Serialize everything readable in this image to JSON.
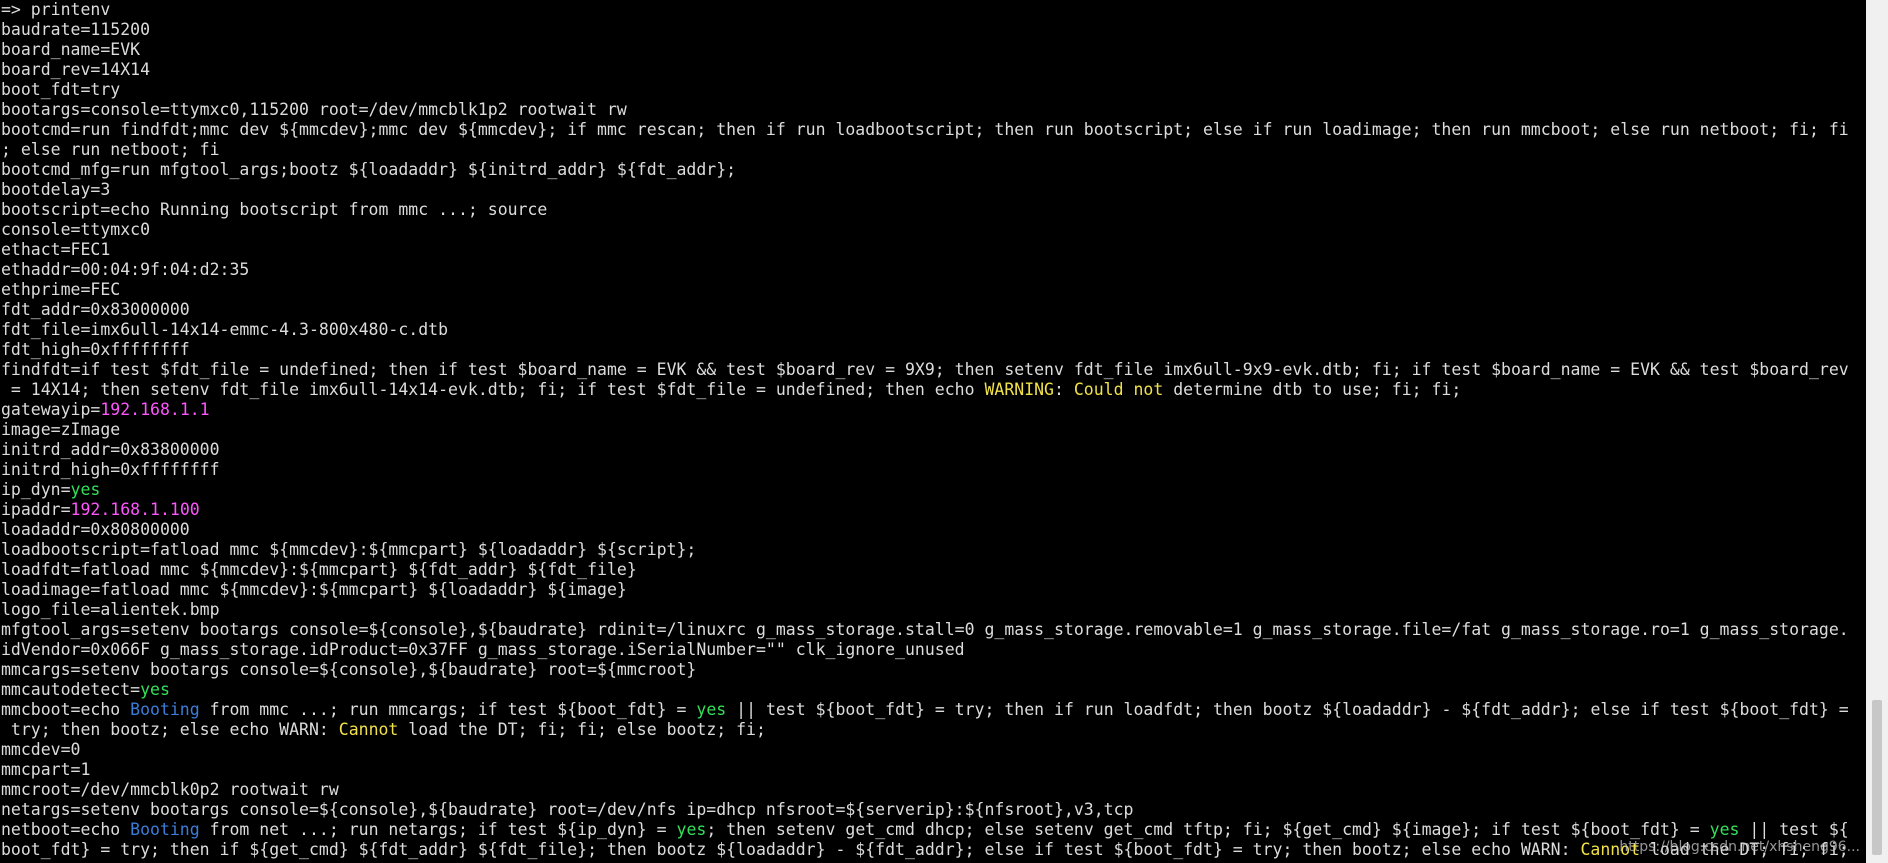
{
  "terminal": {
    "background": "#000000",
    "default_color": "#dcdcdc",
    "lines": [
      [
        {
          "t": "=> printenv"
        }
      ],
      [
        {
          "t": "baudrate=115200"
        }
      ],
      [
        {
          "t": "board_name=EVK"
        }
      ],
      [
        {
          "t": "board_rev=14X14"
        }
      ],
      [
        {
          "t": "boot_fdt=try"
        }
      ],
      [
        {
          "t": "bootargs=console=ttymxc0,115200 root=/dev/mmcblk1p2 rootwait rw"
        }
      ],
      [
        {
          "t": "bootcmd=run findfdt;mmc dev ${mmcdev};mmc dev ${mmcdev}; if mmc rescan; then if run loadbootscript; then run bootscript; else if run loadimage; then run mmcboot; else run netboot; fi; fi"
        }
      ],
      [
        {
          "t": "; else run netboot; fi"
        }
      ],
      [
        {
          "t": "bootcmd_mfg=run mfgtool_args;bootz ${loadaddr} ${initrd_addr} ${fdt_addr};"
        }
      ],
      [
        {
          "t": "bootdelay=3"
        }
      ],
      [
        {
          "t": "bootscript=echo Running bootscript from mmc ...; source"
        }
      ],
      [
        {
          "t": "console=ttymxc0"
        }
      ],
      [
        {
          "t": "ethact=FEC1"
        }
      ],
      [
        {
          "t": "ethaddr=00:04:9f:04:d2:35"
        }
      ],
      [
        {
          "t": "ethprime=FEC"
        }
      ],
      [
        {
          "t": "fdt_addr=0x83000000"
        }
      ],
      [
        {
          "t": "fdt_file=imx6ull-14x14-emmc-4.3-800x480-c.dtb"
        }
      ],
      [
        {
          "t": "fdt_high=0xffffffff"
        }
      ],
      [
        {
          "t": "findfdt=if test $fdt_file = undefined; then if test $board_name = EVK && test $board_rev = 9X9; then setenv fdt_file imx6ull-9x9-evk.dtb; fi; if test $board_name = EVK && test $board_rev"
        }
      ],
      [
        {
          "t": " = 14X14; then setenv fdt_file imx6ull-14x14-evk.dtb; fi; if test $fdt_file = undefined; then echo "
        },
        {
          "t": "WARNING",
          "c": "yellow"
        },
        {
          "t": ": "
        },
        {
          "t": "Could not",
          "c": "yellow"
        },
        {
          "t": " determine dtb to use; fi; fi;"
        }
      ],
      [
        {
          "t": "gatewayip="
        },
        {
          "t": "192.168.1.1",
          "c": "ip"
        }
      ],
      [
        {
          "t": "image=zImage"
        }
      ],
      [
        {
          "t": "initrd_addr=0x83800000"
        }
      ],
      [
        {
          "t": "initrd_high=0xffffffff"
        }
      ],
      [
        {
          "t": "ip_dyn="
        },
        {
          "t": "yes",
          "c": "yes"
        }
      ],
      [
        {
          "t": "ipaddr="
        },
        {
          "t": "192.168.1.100",
          "c": "ip"
        }
      ],
      [
        {
          "t": "loadaddr=0x80800000"
        }
      ],
      [
        {
          "t": "loadbootscript=fatload mmc ${mmcdev}:${mmcpart} ${loadaddr} ${script};"
        }
      ],
      [
        {
          "t": "loadfdt=fatload mmc ${mmcdev}:${mmcpart} ${fdt_addr} ${fdt_file}"
        }
      ],
      [
        {
          "t": "loadimage=fatload mmc ${mmcdev}:${mmcpart} ${loadaddr} ${image}"
        }
      ],
      [
        {
          "t": "logo_file=alientek.bmp"
        }
      ],
      [
        {
          "t": "mfgtool_args=setenv bootargs console=${console},${baudrate} rdinit=/linuxrc g_mass_storage.stall=0 g_mass_storage.removable=1 g_mass_storage.file=/fat g_mass_storage.ro=1 g_mass_storage."
        }
      ],
      [
        {
          "t": "idVendor=0x066F g_mass_storage.idProduct=0x37FF g_mass_storage.iSerialNumber=\"\" clk_ignore_unused"
        }
      ],
      [
        {
          "t": "mmcargs=setenv bootargs console=${console},${baudrate} root=${mmcroot}"
        }
      ],
      [
        {
          "t": "mmcautodetect="
        },
        {
          "t": "yes",
          "c": "yes"
        }
      ],
      [
        {
          "t": "mmcboot=echo "
        },
        {
          "t": "Booting",
          "c": "blue"
        },
        {
          "t": " from mmc ...; run mmcargs; if test ${boot_fdt} = "
        },
        {
          "t": "yes",
          "c": "yes"
        },
        {
          "t": " || test ${boot_fdt} = try; then if run loadfdt; then bootz ${loadaddr} - ${fdt_addr}; else if test ${boot_fdt} ="
        }
      ],
      [
        {
          "t": " try; then bootz; else echo WARN: "
        },
        {
          "t": "Cannot",
          "c": "yellow"
        },
        {
          "t": " load the DT; fi; fi; else bootz; fi;"
        }
      ],
      [
        {
          "t": "mmcdev=0"
        }
      ],
      [
        {
          "t": "mmcpart=1"
        }
      ],
      [
        {
          "t": "mmcroot=/dev/mmcblk0p2 rootwait rw"
        }
      ],
      [
        {
          "t": "netargs=setenv bootargs console=${console},${baudrate} root=/dev/nfs ip=dhcp nfsroot=${serverip}:${nfsroot},v3,tcp"
        }
      ],
      [
        {
          "t": "netboot=echo "
        },
        {
          "t": "Booting",
          "c": "blue"
        },
        {
          "t": " from net ...; run netargs; if test ${ip_dyn} = "
        },
        {
          "t": "yes",
          "c": "yes"
        },
        {
          "t": "; then setenv get_cmd dhcp; else setenv get_cmd tftp; fi; ${get_cmd} ${image}; if test ${boot_fdt} = "
        },
        {
          "t": "yes",
          "c": "yes"
        },
        {
          "t": " || test ${"
        }
      ],
      [
        {
          "t": "boot_fdt} = try; then if ${get_cmd} ${fdt_addr} ${fdt_file}; then bootz ${loadaddr} - ${fdt_addr}; else if test ${boot_fdt} = try; then bootz; else echo WARN: "
        },
        {
          "t": "Cannot",
          "c": "yellow"
        },
        {
          "t": " load the DT; fi; fi;"
        }
      ]
    ]
  },
  "watermark": "https://blog.csdn.net/xhsheng96...",
  "colors": {
    "yes": "#33e05a",
    "ip": "#ff55ff",
    "blue": "#3b7dd8",
    "yellow": "#f0e04a"
  }
}
